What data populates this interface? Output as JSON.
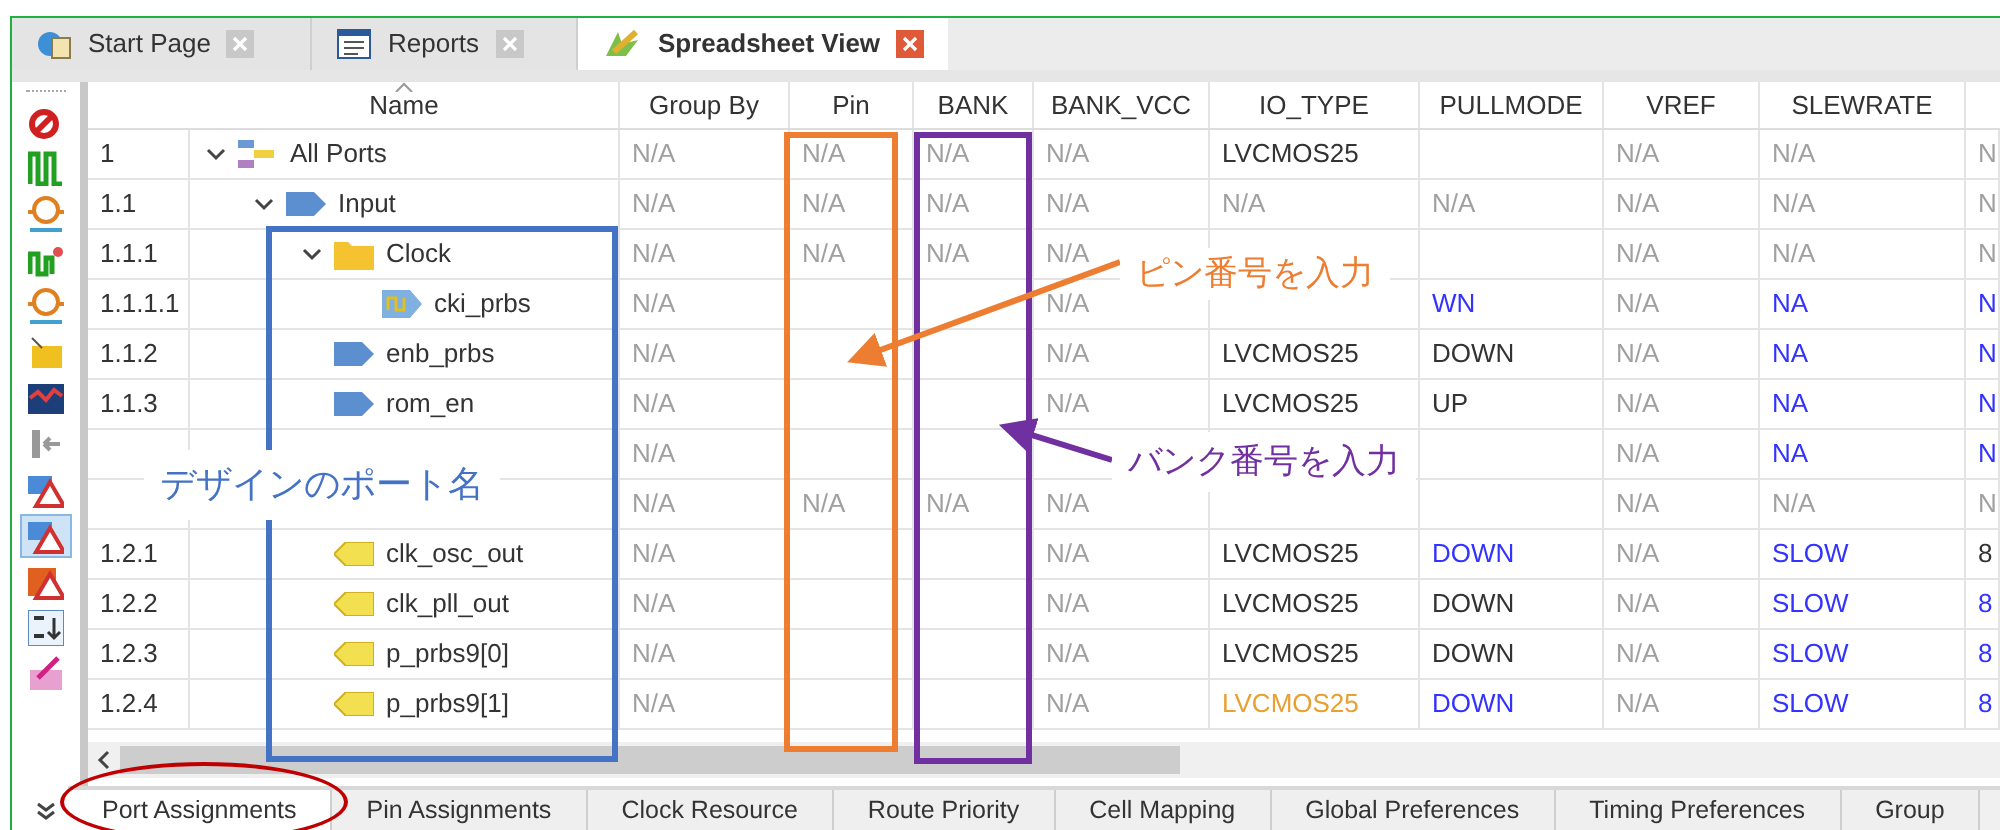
{
  "editor_tabs": [
    {
      "label": "Start Page",
      "kind": "start",
      "selected": false
    },
    {
      "label": "Reports",
      "kind": "reports",
      "selected": false
    },
    {
      "label": "Spreadsheet View",
      "kind": "sheet",
      "selected": true
    }
  ],
  "toolbar": [
    {
      "kind": "noconnect",
      "selected": false
    },
    {
      "kind": "wave",
      "selected": false
    },
    {
      "kind": "circuit",
      "selected": false
    },
    {
      "kind": "wave2",
      "selected": false
    },
    {
      "kind": "circuit",
      "selected": false
    },
    {
      "kind": "folder",
      "selected": false
    },
    {
      "kind": "chart",
      "selected": false
    },
    {
      "kind": "bracket",
      "selected": false
    },
    {
      "kind": "warning",
      "selected": false
    },
    {
      "kind": "warning",
      "selected": true
    },
    {
      "kind": "warning2",
      "selected": false
    },
    {
      "kind": "sort",
      "selected": false
    },
    {
      "kind": "edit",
      "selected": false
    }
  ],
  "table": {
    "name_header": "Name",
    "columns": [
      "Group By",
      "Pin",
      "BANK",
      "BANK_VCC",
      "IO_TYPE",
      "PULLMODE",
      "VREF",
      "SLEWRATE"
    ],
    "rows": [
      {
        "number": "1",
        "name": "All Ports",
        "kind": "all",
        "expanded": true,
        "cells": [
          {
            "text": "N/A",
            "color": "#a0a0a0"
          },
          {
            "text": "N/A",
            "color": "#a0a0a0"
          },
          {
            "text": "N/A",
            "color": "#a0a0a0"
          },
          {
            "text": "N/A",
            "color": "#a0a0a0"
          },
          {
            "text": "LVCMOS25",
            "color": "#333333"
          },
          null,
          {
            "text": "N/A",
            "color": "#a0a0a0"
          },
          {
            "text": "N/A",
            "color": "#a0a0a0"
          },
          {
            "text": "N",
            "color": "#a0a0a0"
          }
        ],
        "children": [
          {
            "number": "1.1",
            "name": "Input",
            "kind": "input",
            "expanded": true,
            "cells": [
              {
                "text": "N/A",
                "color": "#a0a0a0"
              },
              {
                "text": "N/A",
                "color": "#a0a0a0"
              },
              {
                "text": "N/A",
                "color": "#a0a0a0"
              },
              {
                "text": "N/A",
                "color": "#a0a0a0"
              },
              {
                "text": "N/A",
                "color": "#a0a0a0"
              },
              {
                "text": "N/A",
                "color": "#a0a0a0"
              },
              {
                "text": "N/A",
                "color": "#a0a0a0"
              },
              {
                "text": "N/A",
                "color": "#a0a0a0"
              },
              {
                "text": "N",
                "color": "#a0a0a0"
              }
            ],
            "children": [
              {
                "number": "1.1.1",
                "name": "Clock",
                "kind": "folder",
                "expanded": true,
                "cells": [
                  {
                    "text": "N/A",
                    "color": "#a0a0a0"
                  },
                  {
                    "text": "N/A",
                    "color": "#a0a0a0"
                  },
                  {
                    "text": "N/A",
                    "color": "#a0a0a0"
                  },
                  {
                    "text": "N/A",
                    "color": "#a0a0a0"
                  },
                  null,
                  null,
                  {
                    "text": "N/A",
                    "color": "#a0a0a0"
                  },
                  {
                    "text": "N/A",
                    "color": "#a0a0a0"
                  },
                  {
                    "text": "N",
                    "color": "#a0a0a0"
                  }
                ],
                "children": [
                  {
                    "number": "1.1.1.1",
                    "name": "cki_prbs",
                    "kind": "clock",
                    "cells": [
                      {
                        "text": "N/A",
                        "color": "#a0a0a0"
                      },
                      null,
                      null,
                      {
                        "text": "N/A",
                        "color": "#a0a0a0"
                      },
                      null,
                      {
                        "text": "WN",
                        "color": "#3333ff"
                      },
                      {
                        "text": "N/A",
                        "color": "#a0a0a0"
                      },
                      {
                        "text": "NA",
                        "color": "#3333ff"
                      },
                      {
                        "text": "N",
                        "color": "#3333ff"
                      }
                    ]
                  }
                ]
              },
              {
                "number": "1.1.2",
                "name": "enb_prbs",
                "kind": "input",
                "cells": [
                  {
                    "text": "N/A",
                    "color": "#a0a0a0"
                  },
                  null,
                  null,
                  {
                    "text": "N/A",
                    "color": "#a0a0a0"
                  },
                  {
                    "text": "LVCMOS25",
                    "color": "#333333"
                  },
                  {
                    "text": "DOWN",
                    "color": "#333333"
                  },
                  {
                    "text": "N/A",
                    "color": "#a0a0a0"
                  },
                  {
                    "text": "NA",
                    "color": "#3333ff"
                  },
                  {
                    "text": "N",
                    "color": "#3333ff"
                  }
                ]
              },
              {
                "number": "1.1.3",
                "name": "rom_en",
                "kind": "input",
                "cells": [
                  {
                    "text": "N/A",
                    "color": "#a0a0a0"
                  },
                  null,
                  null,
                  {
                    "text": "N/A",
                    "color": "#a0a0a0"
                  },
                  {
                    "text": "LVCMOS25",
                    "color": "#333333"
                  },
                  {
                    "text": "UP",
                    "color": "#333333"
                  },
                  {
                    "text": "N/A",
                    "color": "#a0a0a0"
                  },
                  {
                    "text": "NA",
                    "color": "#3333ff"
                  },
                  {
                    "text": "N",
                    "color": "#3333ff"
                  }
                ]
              },
              {
                "kind": "hidden",
                "cells": [
                  {
                    "text": "N/A",
                    "color": "#a0a0a0"
                  },
                  null,
                  null,
                  null,
                  null,
                  null,
                  {
                    "text": "N/A",
                    "color": "#a0a0a0"
                  },
                  {
                    "text": "NA",
                    "color": "#3333ff"
                  },
                  {
                    "text": "N",
                    "color": "#3333ff"
                  }
                ]
              }
            ]
          },
          {
            "kind": "hidden",
            "cells": [
              {
                "text": "N/A",
                "color": "#a0a0a0"
              },
              {
                "text": "N/A",
                "color": "#a0a0a0"
              },
              {
                "text": "N/A",
                "color": "#a0a0a0"
              },
              {
                "text": "N/A",
                "color": "#a0a0a0"
              },
              null,
              null,
              {
                "text": "N/A",
                "color": "#a0a0a0"
              },
              {
                "text": "N/A",
                "color": "#a0a0a0"
              },
              {
                "text": "N",
                "color": "#a0a0a0"
              }
            ],
            "children": [
              {
                "number": "1.2.1",
                "name": "clk_osc_out",
                "kind": "output",
                "cells": [
                  {
                    "text": "N/A",
                    "color": "#a0a0a0"
                  },
                  null,
                  null,
                  {
                    "text": "N/A",
                    "color": "#a0a0a0"
                  },
                  {
                    "text": "LVCMOS25",
                    "color": "#333333"
                  },
                  {
                    "text": "DOWN",
                    "color": "#3333ff"
                  },
                  {
                    "text": "N/A",
                    "color": "#a0a0a0"
                  },
                  {
                    "text": "SLOW",
                    "color": "#3333ff"
                  },
                  {
                    "text": "8",
                    "color": "#333333"
                  }
                ]
              },
              {
                "number": "1.2.2",
                "name": "clk_pll_out",
                "kind": "output",
                "cells": [
                  {
                    "text": "N/A",
                    "color": "#a0a0a0"
                  },
                  null,
                  null,
                  {
                    "text": "N/A",
                    "color": "#a0a0a0"
                  },
                  {
                    "text": "LVCMOS25",
                    "color": "#333333"
                  },
                  {
                    "text": "DOWN",
                    "color": "#333333"
                  },
                  {
                    "text": "N/A",
                    "color": "#a0a0a0"
                  },
                  {
                    "text": "SLOW",
                    "color": "#3333ff"
                  },
                  {
                    "text": "8",
                    "color": "#3333ff"
                  }
                ]
              },
              {
                "number": "1.2.3",
                "name": "p_prbs9[0]",
                "kind": "output",
                "cells": [
                  {
                    "text": "N/A",
                    "color": "#a0a0a0"
                  },
                  null,
                  null,
                  {
                    "text": "N/A",
                    "color": "#a0a0a0"
                  },
                  {
                    "text": "LVCMOS25",
                    "color": "#333333"
                  },
                  {
                    "text": "DOWN",
                    "color": "#333333"
                  },
                  {
                    "text": "N/A",
                    "color": "#a0a0a0"
                  },
                  {
                    "text": "SLOW",
                    "color": "#3333ff"
                  },
                  {
                    "text": "8",
                    "color": "#3333ff"
                  }
                ]
              },
              {
                "number": "1.2.4",
                "name": "p_prbs9[1]",
                "kind": "output",
                "cells": [
                  {
                    "text": "N/A",
                    "color": "#a0a0a0"
                  },
                  null,
                  null,
                  {
                    "text": "N/A",
                    "color": "#a0a0a0"
                  },
                  {
                    "text": "LVCMOS25",
                    "color": "#e8a030"
                  },
                  {
                    "text": "DOWN",
                    "color": "#3333ff"
                  },
                  {
                    "text": "N/A",
                    "color": "#a0a0a0"
                  },
                  {
                    "text": "SLOW",
                    "color": "#3333ff"
                  },
                  {
                    "text": "8",
                    "color": "#3333ff"
                  }
                ]
              }
            ]
          }
        ]
      }
    ]
  },
  "annotations": [
    {
      "text": "ピン番号を入力",
      "color": "#ed7d31"
    },
    {
      "text": "バンク番号を入力",
      "color": "#7030a0"
    },
    {
      "text": "デザインのポート名",
      "color": "#4472c4"
    },
    {
      "kind": "tab-circle",
      "color": "#c00000"
    }
  ],
  "bottom_tabs": [
    {
      "label": "Port Assignments",
      "selected": true
    },
    {
      "label": "Pin Assignments",
      "selected": false
    },
    {
      "label": "Clock Resource",
      "selected": false
    },
    {
      "label": "Route Priority",
      "selected": false
    },
    {
      "label": "Cell Mapping",
      "selected": false
    },
    {
      "label": "Global Preferences",
      "selected": false
    },
    {
      "label": "Timing Preferences",
      "selected": false
    },
    {
      "label": "Group",
      "selected": false
    }
  ]
}
